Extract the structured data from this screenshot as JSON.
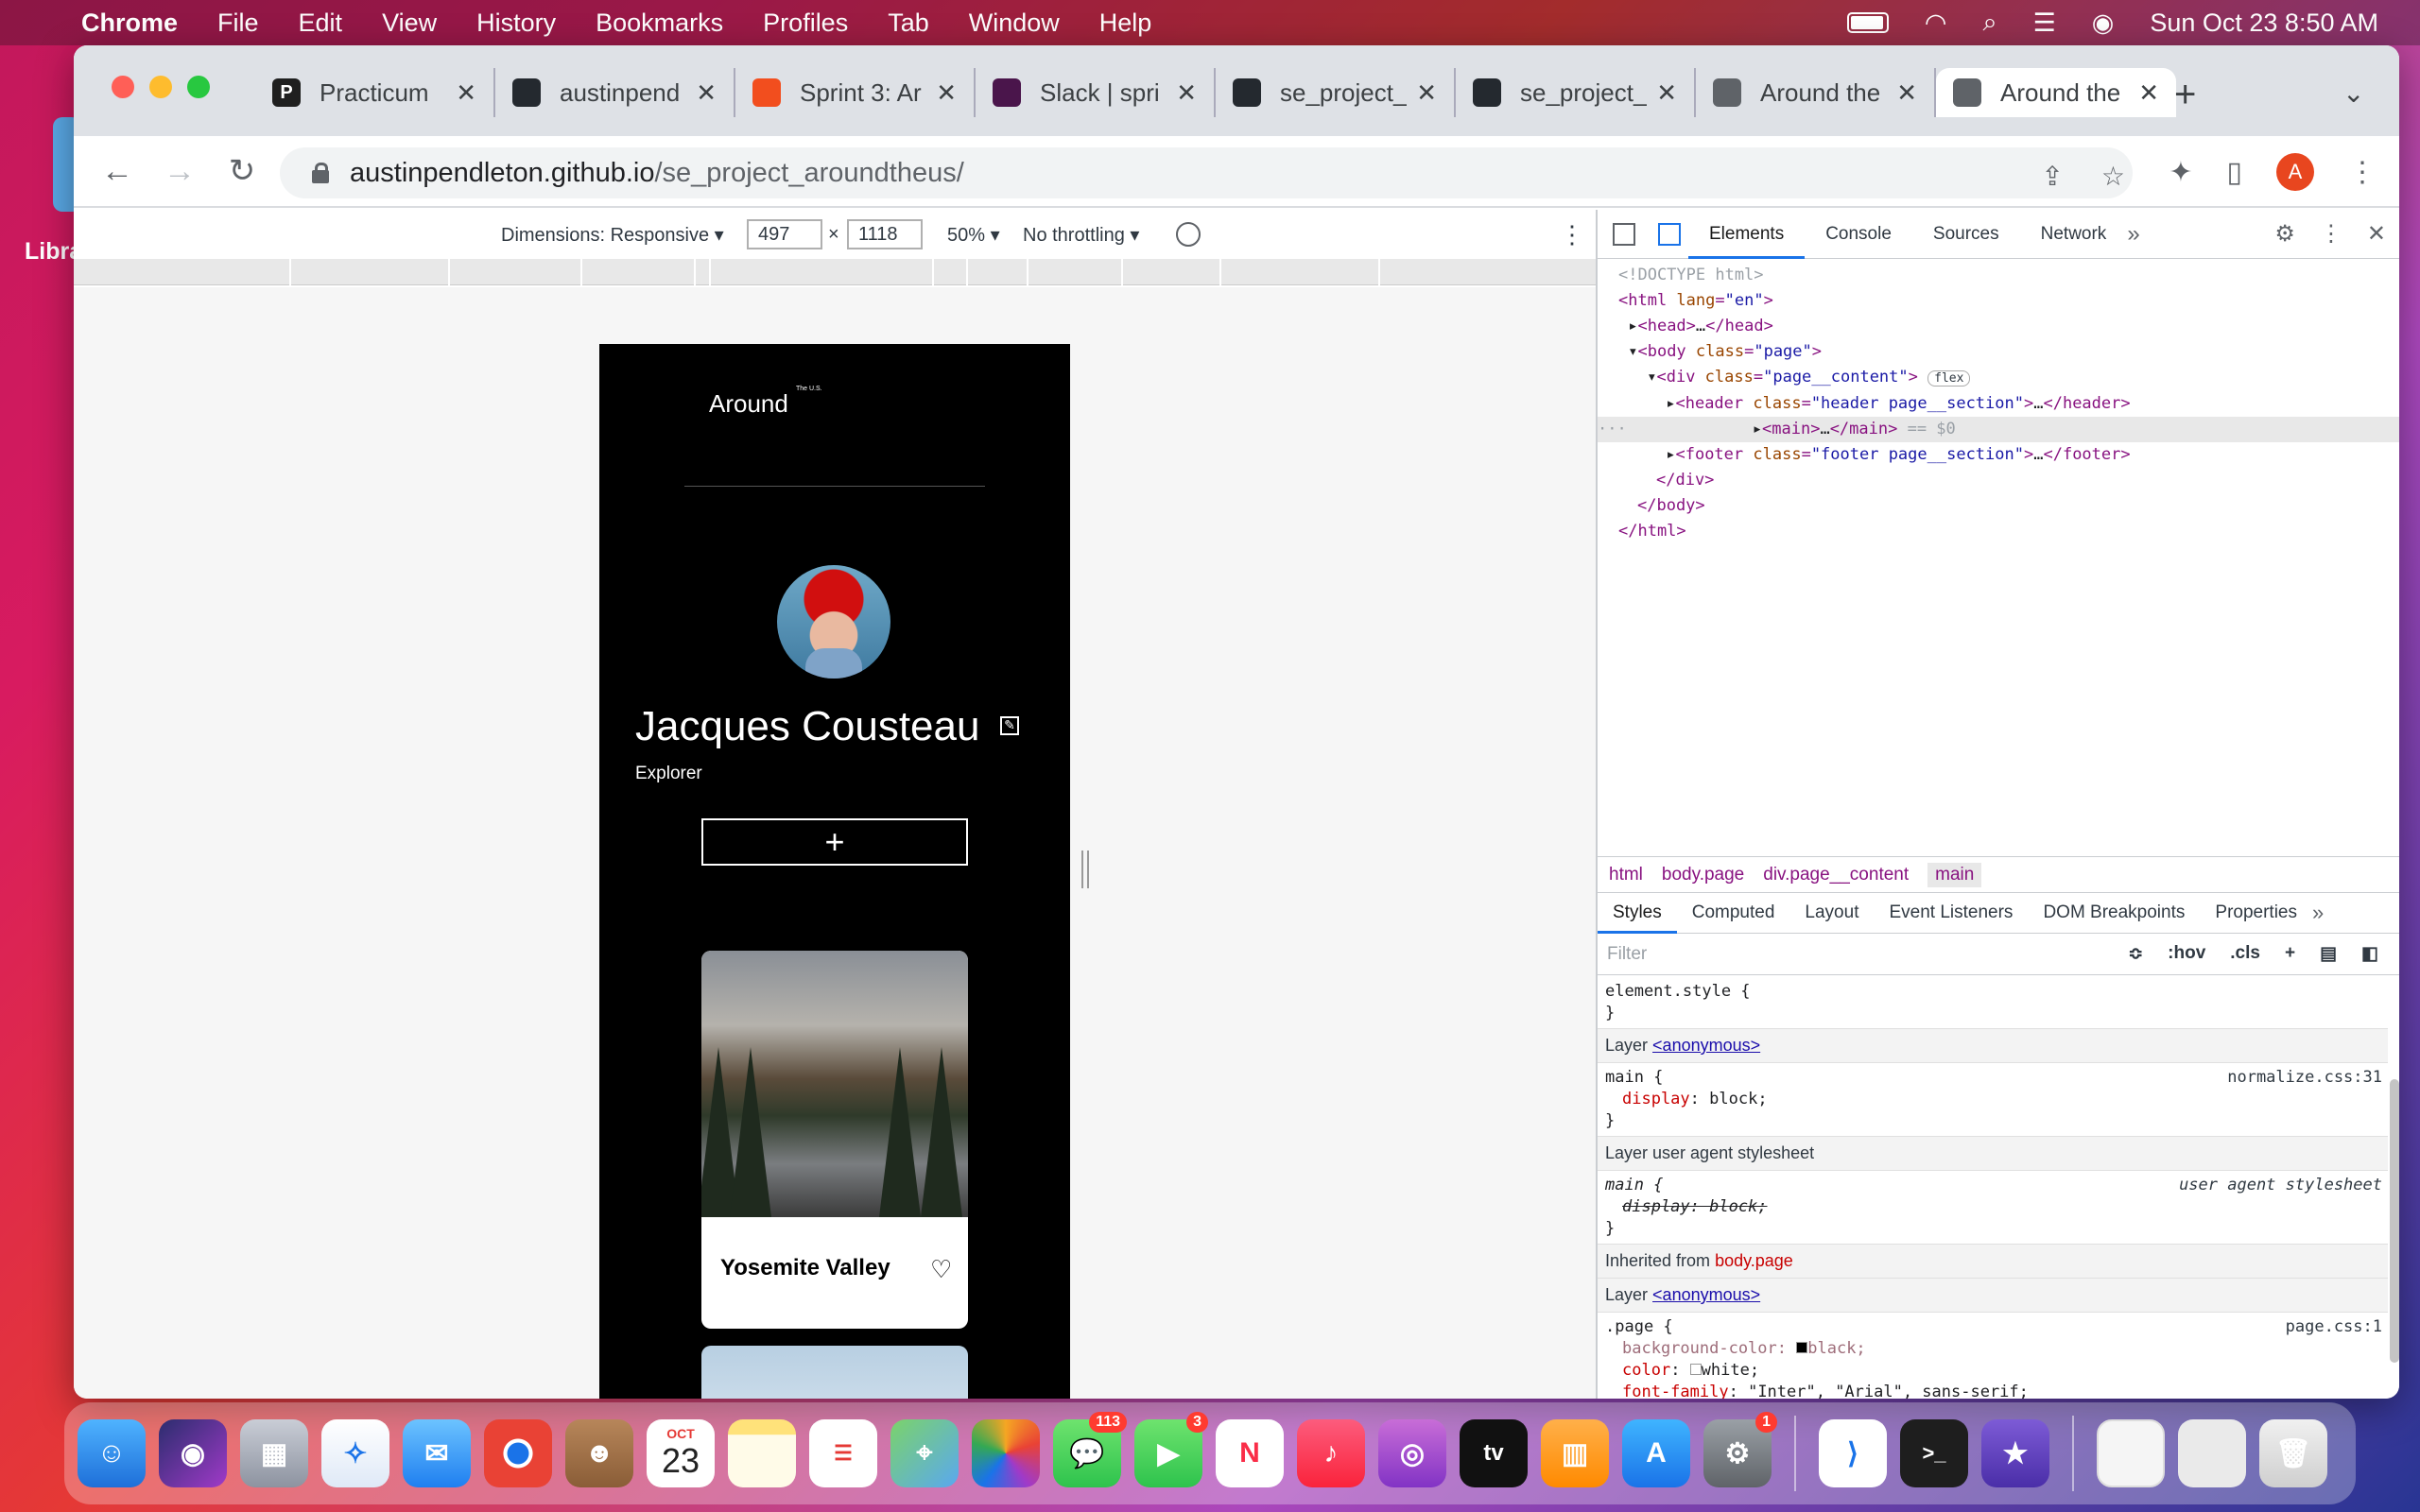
{
  "menubar": {
    "app": "Chrome",
    "items": [
      "File",
      "Edit",
      "View",
      "History",
      "Bookmarks",
      "Profiles",
      "Tab",
      "Window",
      "Help"
    ],
    "clock": "Sun Oct 23  8:50 AM"
  },
  "desktop": {
    "label": "Libra"
  },
  "tabs": [
    {
      "title": "Practicum",
      "icon": "practicum-icon",
      "color": "#1f1f1f",
      "glyph": "P"
    },
    {
      "title": "austinpend",
      "icon": "github-icon",
      "color": "#24292f",
      "glyph": ""
    },
    {
      "title": "Sprint 3: Ar",
      "icon": "figma-icon",
      "color": "#f24e1e",
      "glyph": ""
    },
    {
      "title": "Slack | spri",
      "icon": "slack-icon",
      "color": "#4a154b",
      "glyph": ""
    },
    {
      "title": "se_project_",
      "icon": "github-icon",
      "color": "#24292f",
      "glyph": ""
    },
    {
      "title": "se_project_",
      "icon": "github-icon",
      "color": "#24292f",
      "glyph": ""
    },
    {
      "title": "Around the",
      "icon": "globe-icon",
      "color": "#5f6368",
      "glyph": ""
    },
    {
      "title": "Around the",
      "icon": "globe-icon",
      "color": "#5f6368",
      "glyph": "",
      "active": true
    }
  ],
  "url": {
    "host": "austinpendleton.github.io",
    "path": "/se_project_aroundtheus/"
  },
  "profile_initial": "A",
  "device_toolbar": {
    "dimensions_label": "Dimensions: Responsive ▾",
    "width": "497",
    "times": "×",
    "height": "1118",
    "zoom": "50% ▾",
    "throttling": "No throttling ▾"
  },
  "site": {
    "logo": "Around",
    "logo_sup": "The U.S.",
    "profile_name": "Jacques Cousteau",
    "profile_job": "Explorer",
    "add_glyph": "+",
    "card": {
      "title": "Yosemite Valley"
    }
  },
  "devtools": {
    "tabs": [
      "Elements",
      "Console",
      "Sources",
      "Network"
    ],
    "active_tab": "Elements",
    "breadcrumbs": [
      "html",
      "body.page",
      "div.page__content",
      "main"
    ],
    "subtabs": [
      "Styles",
      "Computed",
      "Layout",
      "Event Listeners",
      "DOM Breakpoints",
      "Properties"
    ],
    "filter_placeholder": "Filter",
    "filter_tools": [
      ":hov",
      ".cls"
    ],
    "flex_badge": "flex",
    "styles": {
      "element_style": "element.style {",
      "layer1": "Layer",
      "layer_link": "<anonymous>",
      "main_sel": "main {",
      "main_src": "normalize.css:31",
      "main_prop": "display",
      "main_val": "block;",
      "ua_layer": "Layer user agent stylesheet",
      "ua_src": "user agent stylesheet",
      "ua_decl": "display: block;",
      "inherited": "Inherited from",
      "inherited_sel": "body.page",
      "page_sel": ".page {",
      "page_src": "page.css:1",
      "bg_prop": "background-color",
      "bg_val": "black;",
      "color_prop": "color",
      "color_val": "white;",
      "font_prop": "font-family",
      "font_val": "\"Inter\", \"Arial\", sans-serif;",
      "close": "}"
    }
  },
  "dock": {
    "calendar_month": "OCT",
    "calendar_day": "23",
    "messages_badge": "113",
    "facetime_badge": "3",
    "settings_badge": "1",
    "tv_label": "tv"
  }
}
